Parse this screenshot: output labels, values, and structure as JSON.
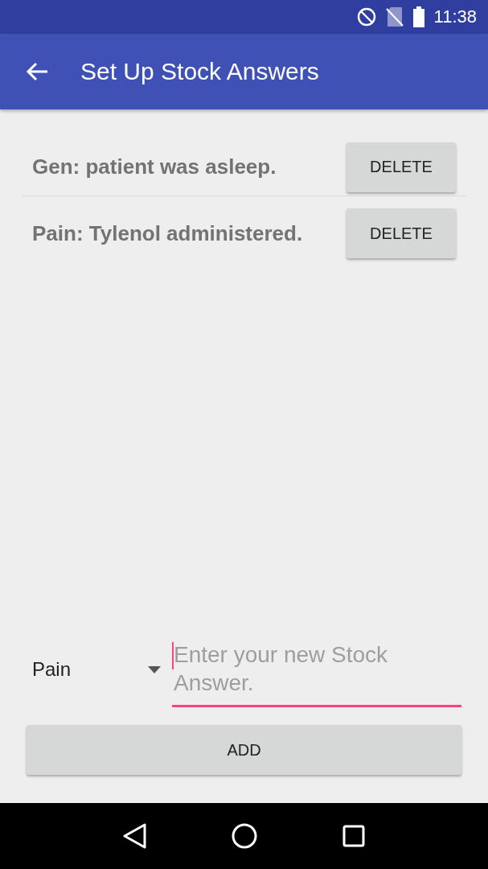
{
  "status_bar": {
    "time": "11:38"
  },
  "app_bar": {
    "title": "Set Up Stock Answers"
  },
  "answers": [
    {
      "text": "Gen: patient was asleep.",
      "button": "DELETE"
    },
    {
      "text": "Pain: Tylenol administered.",
      "button": "DELETE"
    }
  ],
  "new_answer": {
    "category": "Pain",
    "placeholder": "Enter your new Stock Answer.",
    "focused": true
  },
  "add_button": "ADD"
}
